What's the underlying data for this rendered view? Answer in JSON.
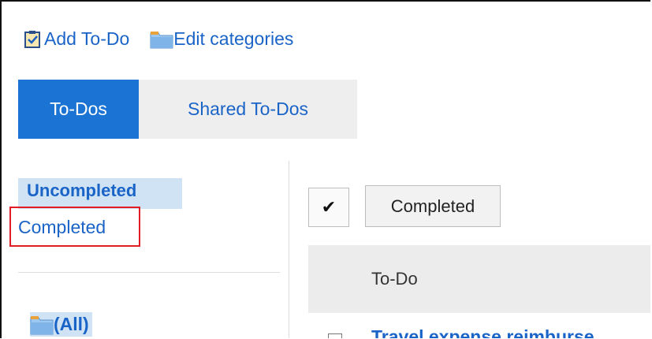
{
  "toolbar": {
    "add_todo_label": "Add To-Do",
    "edit_categories_label": "Edit categories"
  },
  "tabs": [
    {
      "label": "To-Dos",
      "active": true
    },
    {
      "label": "Shared To-Dos",
      "active": false
    }
  ],
  "status_filters": {
    "uncompleted": "Uncompleted",
    "completed": "Completed"
  },
  "categories": {
    "all": "(All)"
  },
  "actions": {
    "select_all_glyph": "✔",
    "completed_button": "Completed"
  },
  "table": {
    "header": "To-Do",
    "rows": [
      {
        "title": "Travel expense reimburse"
      }
    ]
  },
  "icons": {
    "add_todo": "checklist-icon",
    "edit_categories": "folder-icon",
    "category_all": "folder-icon"
  },
  "colors": {
    "link": "#1a64c8",
    "active_tab": "#1b74d3",
    "highlight": "#cfe3f5",
    "red_outline": "#e21c24"
  }
}
